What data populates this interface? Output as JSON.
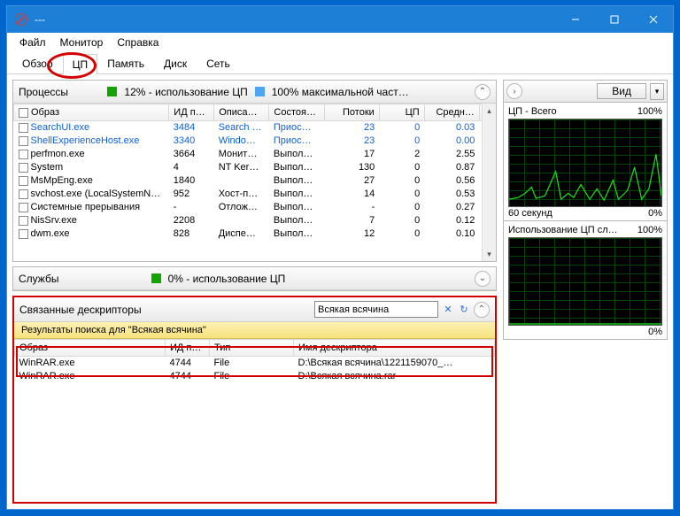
{
  "window": {
    "title": "---"
  },
  "menu": {
    "file": "Файл",
    "monitor": "Монитор",
    "help": "Справка"
  },
  "tabs": {
    "overview": "Обзор",
    "cpu": "ЦП",
    "memory": "Память",
    "disk": "Диск",
    "network": "Сеть"
  },
  "processes": {
    "title": "Процессы",
    "stat1": "12% - использование ЦП",
    "stat2": "100% максимальной част…",
    "cols": {
      "image": "Образ",
      "pid": "ИД п…",
      "desc": "Описа…",
      "status": "Состоя…",
      "threads": "Потоки",
      "cpu": "ЦП",
      "avg": "Средн…"
    },
    "rows": [
      {
        "image": "SearchUI.exe",
        "pid": "3484",
        "desc": "Search …",
        "status": "Приос…",
        "threads": "23",
        "cpu": "0",
        "avg": "0.03",
        "link": true
      },
      {
        "image": "ShellExperienceHost.exe",
        "pid": "3340",
        "desc": "Windo…",
        "status": "Приос…",
        "threads": "23",
        "cpu": "0",
        "avg": "0.00",
        "link": true
      },
      {
        "image": "perfmon.exe",
        "pid": "3664",
        "desc": "Монит…",
        "status": "Выпол…",
        "threads": "17",
        "cpu": "2",
        "avg": "2.55"
      },
      {
        "image": "System",
        "pid": "4",
        "desc": "NT Ker…",
        "status": "Выпол…",
        "threads": "130",
        "cpu": "0",
        "avg": "0.87"
      },
      {
        "image": "MsMpEng.exe",
        "pid": "1840",
        "desc": "",
        "status": "Выпол…",
        "threads": "27",
        "cpu": "0",
        "avg": "0.56"
      },
      {
        "image": "svchost.exe (LocalSystemNet…",
        "pid": "952",
        "desc": "Хост-п…",
        "status": "Выпол…",
        "threads": "14",
        "cpu": "0",
        "avg": "0.53"
      },
      {
        "image": "Системные прерывания",
        "pid": "-",
        "desc": "Отлож…",
        "status": "Выпол…",
        "threads": "-",
        "cpu": "0",
        "avg": "0.27"
      },
      {
        "image": "NisSrv.exe",
        "pid": "2208",
        "desc": "",
        "status": "Выпол…",
        "threads": "7",
        "cpu": "0",
        "avg": "0.12"
      },
      {
        "image": "dwm.exe",
        "pid": "828",
        "desc": "Диспе…",
        "status": "Выпол…",
        "threads": "12",
        "cpu": "0",
        "avg": "0.10"
      }
    ]
  },
  "services": {
    "title": "Службы",
    "stat": "0% - использование ЦП"
  },
  "descriptors": {
    "title": "Связанные дескрипторы",
    "search_value": "Всякая всячина",
    "results_label": "Результаты поиска для \"Всякая всячина\"",
    "cols": {
      "image": "Образ",
      "pid": "ИД п…",
      "type": "Тип",
      "name": "Имя дескриптора"
    },
    "rows": [
      {
        "image": "WinRAR.exe",
        "pid": "4744",
        "type": "File",
        "name": "D:\\Всякая всячина\\1221159070_…"
      },
      {
        "image": "WinRAR.exe",
        "pid": "4744",
        "type": "File",
        "name": "D:\\Всякая всячина.rar"
      }
    ]
  },
  "right": {
    "view_label": "Вид",
    "cpu_total_title": "ЦП - Всего",
    "cpu_total_pct": "100%",
    "sixty_sec": "60 секунд",
    "zero": "0%",
    "cpu_service_title": "Использование ЦП сл…",
    "cpu_service_pct": "100%"
  }
}
